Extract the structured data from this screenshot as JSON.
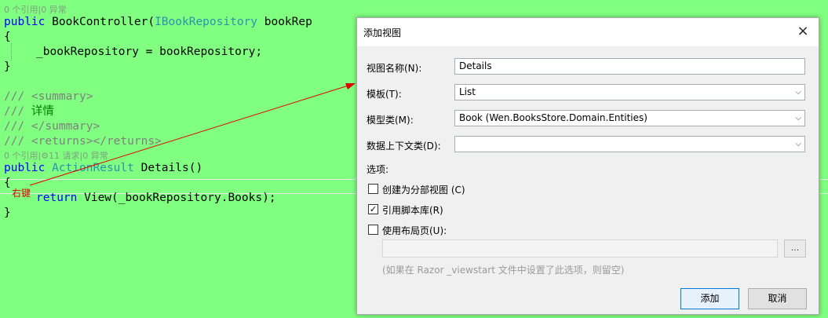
{
  "editor": {
    "lens1": "0 个引用|0 异常",
    "ctor_public": "public ",
    "ctor_name": "BookController(",
    "ctor_param_type": "IBookRepository",
    "ctor_param_rest": " bookRep",
    "brace_open1": "{",
    "assign_line": "_bookRepository = bookRepository;",
    "brace_close1": "}",
    "doc_summary_open_prefix": "/// ",
    "doc_summary_open_tag": "<summary>",
    "doc_detail_prefix": "/// ",
    "doc_detail_text": "详情",
    "doc_summary_close_prefix": "/// ",
    "doc_summary_close_tag": "</summary>",
    "doc_returns_prefix": "/// ",
    "doc_returns_tag": "<returns></returns>",
    "lens2": "0 个引用|⚙11 请求|0 异常",
    "method_public": "public ",
    "method_type": "ActionResult",
    "method_rest": " Details()",
    "brace_open2": "{",
    "return_kw": "return",
    "return_rest": " View(_bookRepository.Books);",
    "brace_close2": "}",
    "annotation": "右键",
    "annotation_color": "#e00000"
  },
  "dialog": {
    "title": "添加视图",
    "close_icon": "×",
    "view_name_label": "视图名称(N):",
    "view_name_value": "Details",
    "template_label": "模板(T):",
    "template_value": "List",
    "model_label": "模型类(M):",
    "model_value": "Book (Wen.BooksStore.Domain.Entities)",
    "context_label": "数据上下文类(D):",
    "context_value": "",
    "options_label": "选项:",
    "opt_partial": "创建为分部视图 (C)",
    "opt_partial_checked": false,
    "opt_scripts": "引用脚本库(R)",
    "opt_scripts_checked": true,
    "opt_layout": "使用布局页(U):",
    "opt_layout_checked": false,
    "browse_label": "...",
    "hint": "(如果在 Razor _viewstart 文件中设置了此选项，则留空)",
    "add_button": "添加",
    "cancel_button": "取消",
    "dropdown_icon": "⌵",
    "check_mark": "✓"
  }
}
